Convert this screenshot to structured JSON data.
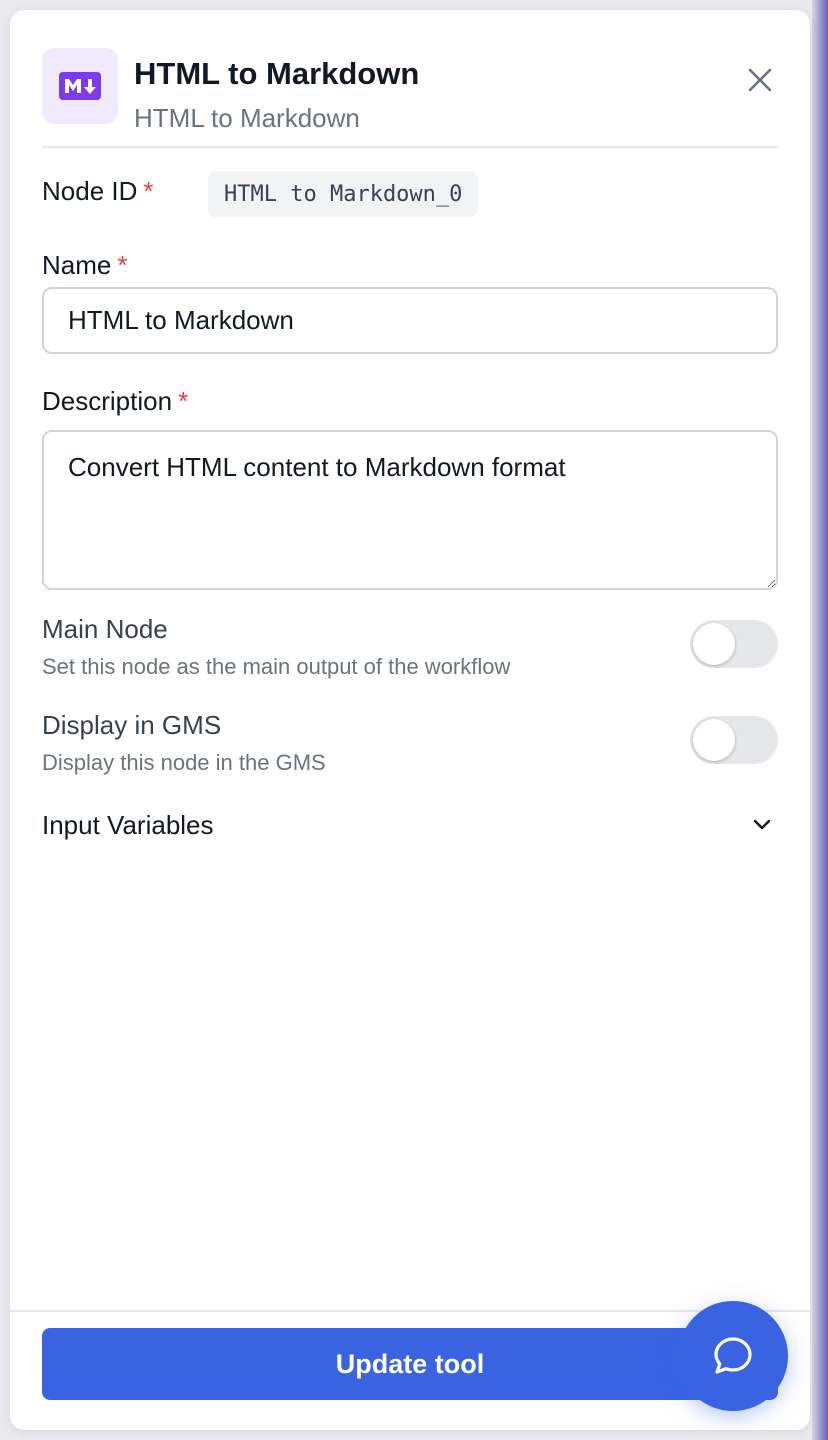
{
  "header": {
    "title": "HTML to Markdown",
    "subtitle": "HTML to Markdown",
    "icon": "markdown-icon",
    "icon_color": "#7c3aed",
    "icon_bg": "#f1eafd"
  },
  "fields": {
    "node_id_label": "Node ID",
    "node_id_value": "HTML to Markdown_0",
    "name_label": "Name",
    "name_value": "HTML to Markdown",
    "description_label": "Description",
    "description_value": "Convert HTML content to Markdown format",
    "required_mark": "*"
  },
  "toggles": {
    "main_node": {
      "title": "Main Node",
      "description": "Set this node as the main output of the workflow",
      "on": false
    },
    "display_gms": {
      "title": "Display in GMS",
      "description": "Display this node in the GMS",
      "on": false
    }
  },
  "sections": {
    "input_variables": "Input Variables"
  },
  "footer": {
    "update_label": "Update tool",
    "accent": "#3a63e2"
  }
}
